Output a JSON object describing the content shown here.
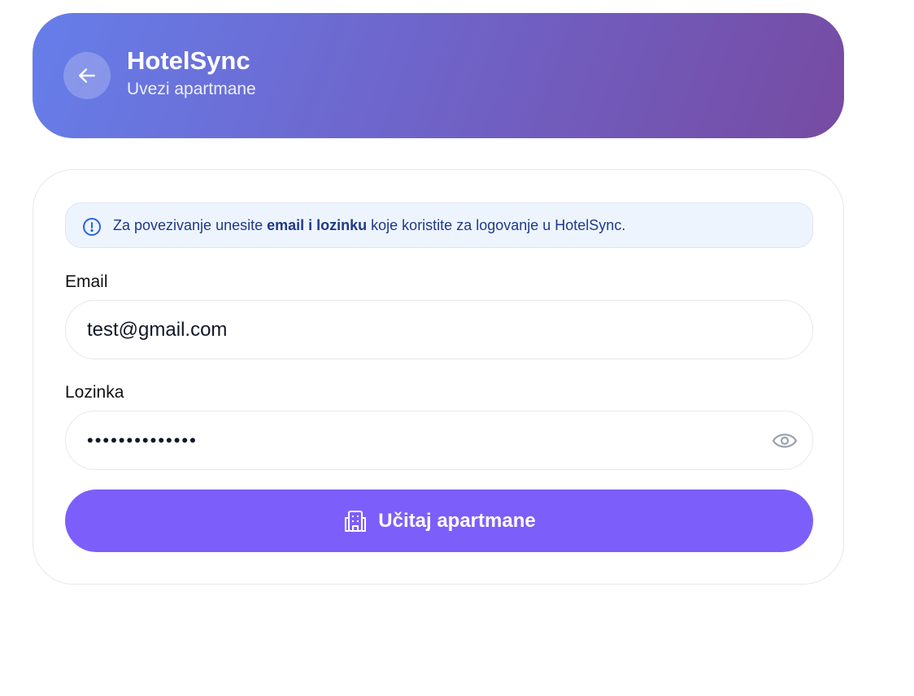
{
  "header": {
    "title": "HotelSync",
    "subtitle": "Uvezi apartmane",
    "back_icon": "arrow-left-icon"
  },
  "info": {
    "icon": "info-circle-icon",
    "text_before": "Za povezivanje unesite ",
    "text_bold": "email i lozinku",
    "text_after": " koje koristite za logovanje u HotelSync."
  },
  "form": {
    "email_label": "Email",
    "email_value": "test@gmail.com",
    "password_label": "Lozinka",
    "password_masked": "••••••••••••••",
    "password_toggle_icon": "eye-icon",
    "submit_label": "Učitaj apartmane",
    "submit_icon": "building-icon"
  },
  "colors": {
    "header_gradient_start": "#667eea",
    "header_gradient_end": "#764ba2",
    "submit_bg": "#7c5ffb",
    "info_bg": "#eef4fd",
    "info_text": "#1e3a8a"
  }
}
